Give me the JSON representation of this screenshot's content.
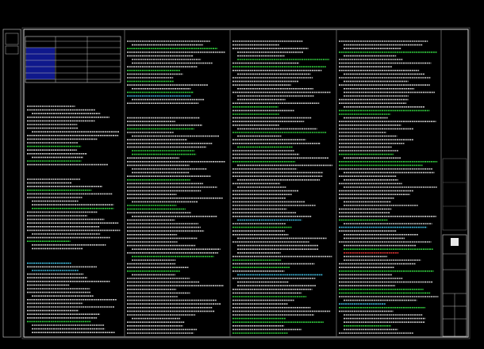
{
  "viewer": {
    "background_color": "#000000"
  },
  "drawing": {
    "title": "",
    "stamp_texts": [
      "",
      "",
      "",
      ""
    ],
    "title_block_texts": [
      "",
      "",
      ""
    ],
    "legend_table": {
      "headers": [
        "",
        "",
        ""
      ],
      "rows": [
        [
          "",
          "",
          ""
        ],
        [
          "",
          "",
          ""
        ],
        [
          "",
          "",
          ""
        ],
        [
          "",
          "",
          ""
        ],
        [
          "",
          "",
          ""
        ],
        [
          "",
          "",
          ""
        ]
      ]
    },
    "columns": [
      {
        "section_headings": [
          "",
          "",
          "",
          ""
        ]
      },
      {
        "section_headings": [
          "",
          "",
          "",
          ""
        ]
      },
      {
        "section_headings": [
          "",
          "",
          "",
          ""
        ]
      },
      {
        "section_headings": [
          "",
          "",
          "",
          ""
        ]
      }
    ],
    "colors": {
      "frame": "#d8d8d8",
      "body_text": "#e8e8e8",
      "highlight_text": "#3cf04a",
      "heading_text": "#ffd23c",
      "emphasis_text": "#ff3c3c",
      "accent_text": "#4ad7ff",
      "legend_fill": "#1c2cff"
    }
  }
}
